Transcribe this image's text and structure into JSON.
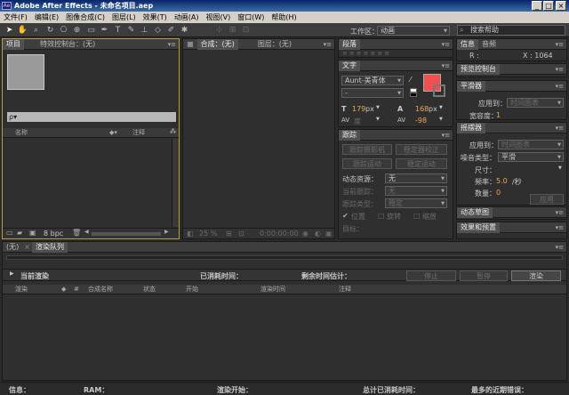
{
  "window": {
    "title": "Adobe After Effects - 未命名项目.aep",
    "logo": "Ae"
  },
  "menu": [
    "文件(F)",
    "编辑(E)",
    "图像合成(C)",
    "图层(L)",
    "效果(T)",
    "动画(A)",
    "视图(V)",
    "窗口(W)",
    "帮助(H)"
  ],
  "toolbar": {
    "workspace_label": "工作区：",
    "workspace_value": "动画",
    "search_placeholder": "搜索帮助"
  },
  "project": {
    "tab_project": "项目",
    "tab_effect": "特效控制台：(无)",
    "search_value": "ρ▾",
    "col_name": "名称",
    "col_note": "注释",
    "bpc": "8 bpc"
  },
  "composition": {
    "tab_comp": "合成：(无)",
    "tab_layer": "图层：(无)",
    "zoom": "25 %",
    "timecode": "0:00:00:00"
  },
  "paragraph": {
    "title": "段落"
  },
  "text": {
    "title": "文字",
    "font": "Aunt-美青体",
    "style": "-",
    "size_value": "179",
    "size_unit": "px",
    "leading_value": "168",
    "leading_unit": "px",
    "kerning": "度",
    "tracking": "-98",
    "fill_color": "#f05050"
  },
  "tracker": {
    "title": "跟踪",
    "btn_track_camera": "跟踪摄影机",
    "btn_warp_stabilizer": "稳定器校正",
    "btn_track_motion": "跟踪运动",
    "btn_stabilize": "稳定运动",
    "motion_source_label": "动态资源：",
    "motion_source_value": "无",
    "current_track_label": "当前跟踪：",
    "current_track_value": "无",
    "track_type_label": "跟踪类型：",
    "track_type_value": "稳定",
    "position_label": "位置",
    "rotation_label": "旋转",
    "scale_label": "缩放",
    "target_label": "目标："
  },
  "info": {
    "tab_info": "信息",
    "tab_audio": "音频",
    "r_label": "R :",
    "x_label": "X : 1064"
  },
  "preview": {
    "title": "预览控制台"
  },
  "smoother": {
    "title": "平滑器",
    "apply_label": "应用到：",
    "apply_value": "时间图表",
    "tolerance_label": "宽容度：",
    "tolerance_value": "1"
  },
  "wiggler": {
    "title": "摇摆器",
    "apply_label": "应用到：",
    "apply_value": "时间图表",
    "noise_label": "噪音类型：",
    "noise_value": "平滑",
    "dimension_label": "尺寸：",
    "freq_label": "频率：",
    "freq_value": "5.0",
    "freq_unit": "/秒",
    "count_label": "数量：",
    "count_value": "0",
    "apply_button": "应用"
  },
  "dynamic_sketch": {
    "title": "动态草图"
  },
  "effects_presets": {
    "title": "效果和预置"
  },
  "render": {
    "tab_none": "(无)",
    "tab_queue": "渲染队列",
    "current_render": "当前渲染",
    "elapsed_label": "已消耗时间：",
    "remaining_label": "剩余时间估计：",
    "stop_button": "停止",
    "pause_button": "暂停",
    "render_button": "渲染",
    "col_render": "渲染",
    "col_num": "#",
    "col_comp": "合成名称",
    "col_status": "状态",
    "col_start": "开始",
    "col_time": "渲染时间",
    "col_note": "注释"
  },
  "status": {
    "info": "信息：",
    "ram": "RAM：",
    "render_start": "渲染开始：",
    "total_elapsed": "总计已消耗时间：",
    "recent_errors": "最多的近期错误："
  }
}
